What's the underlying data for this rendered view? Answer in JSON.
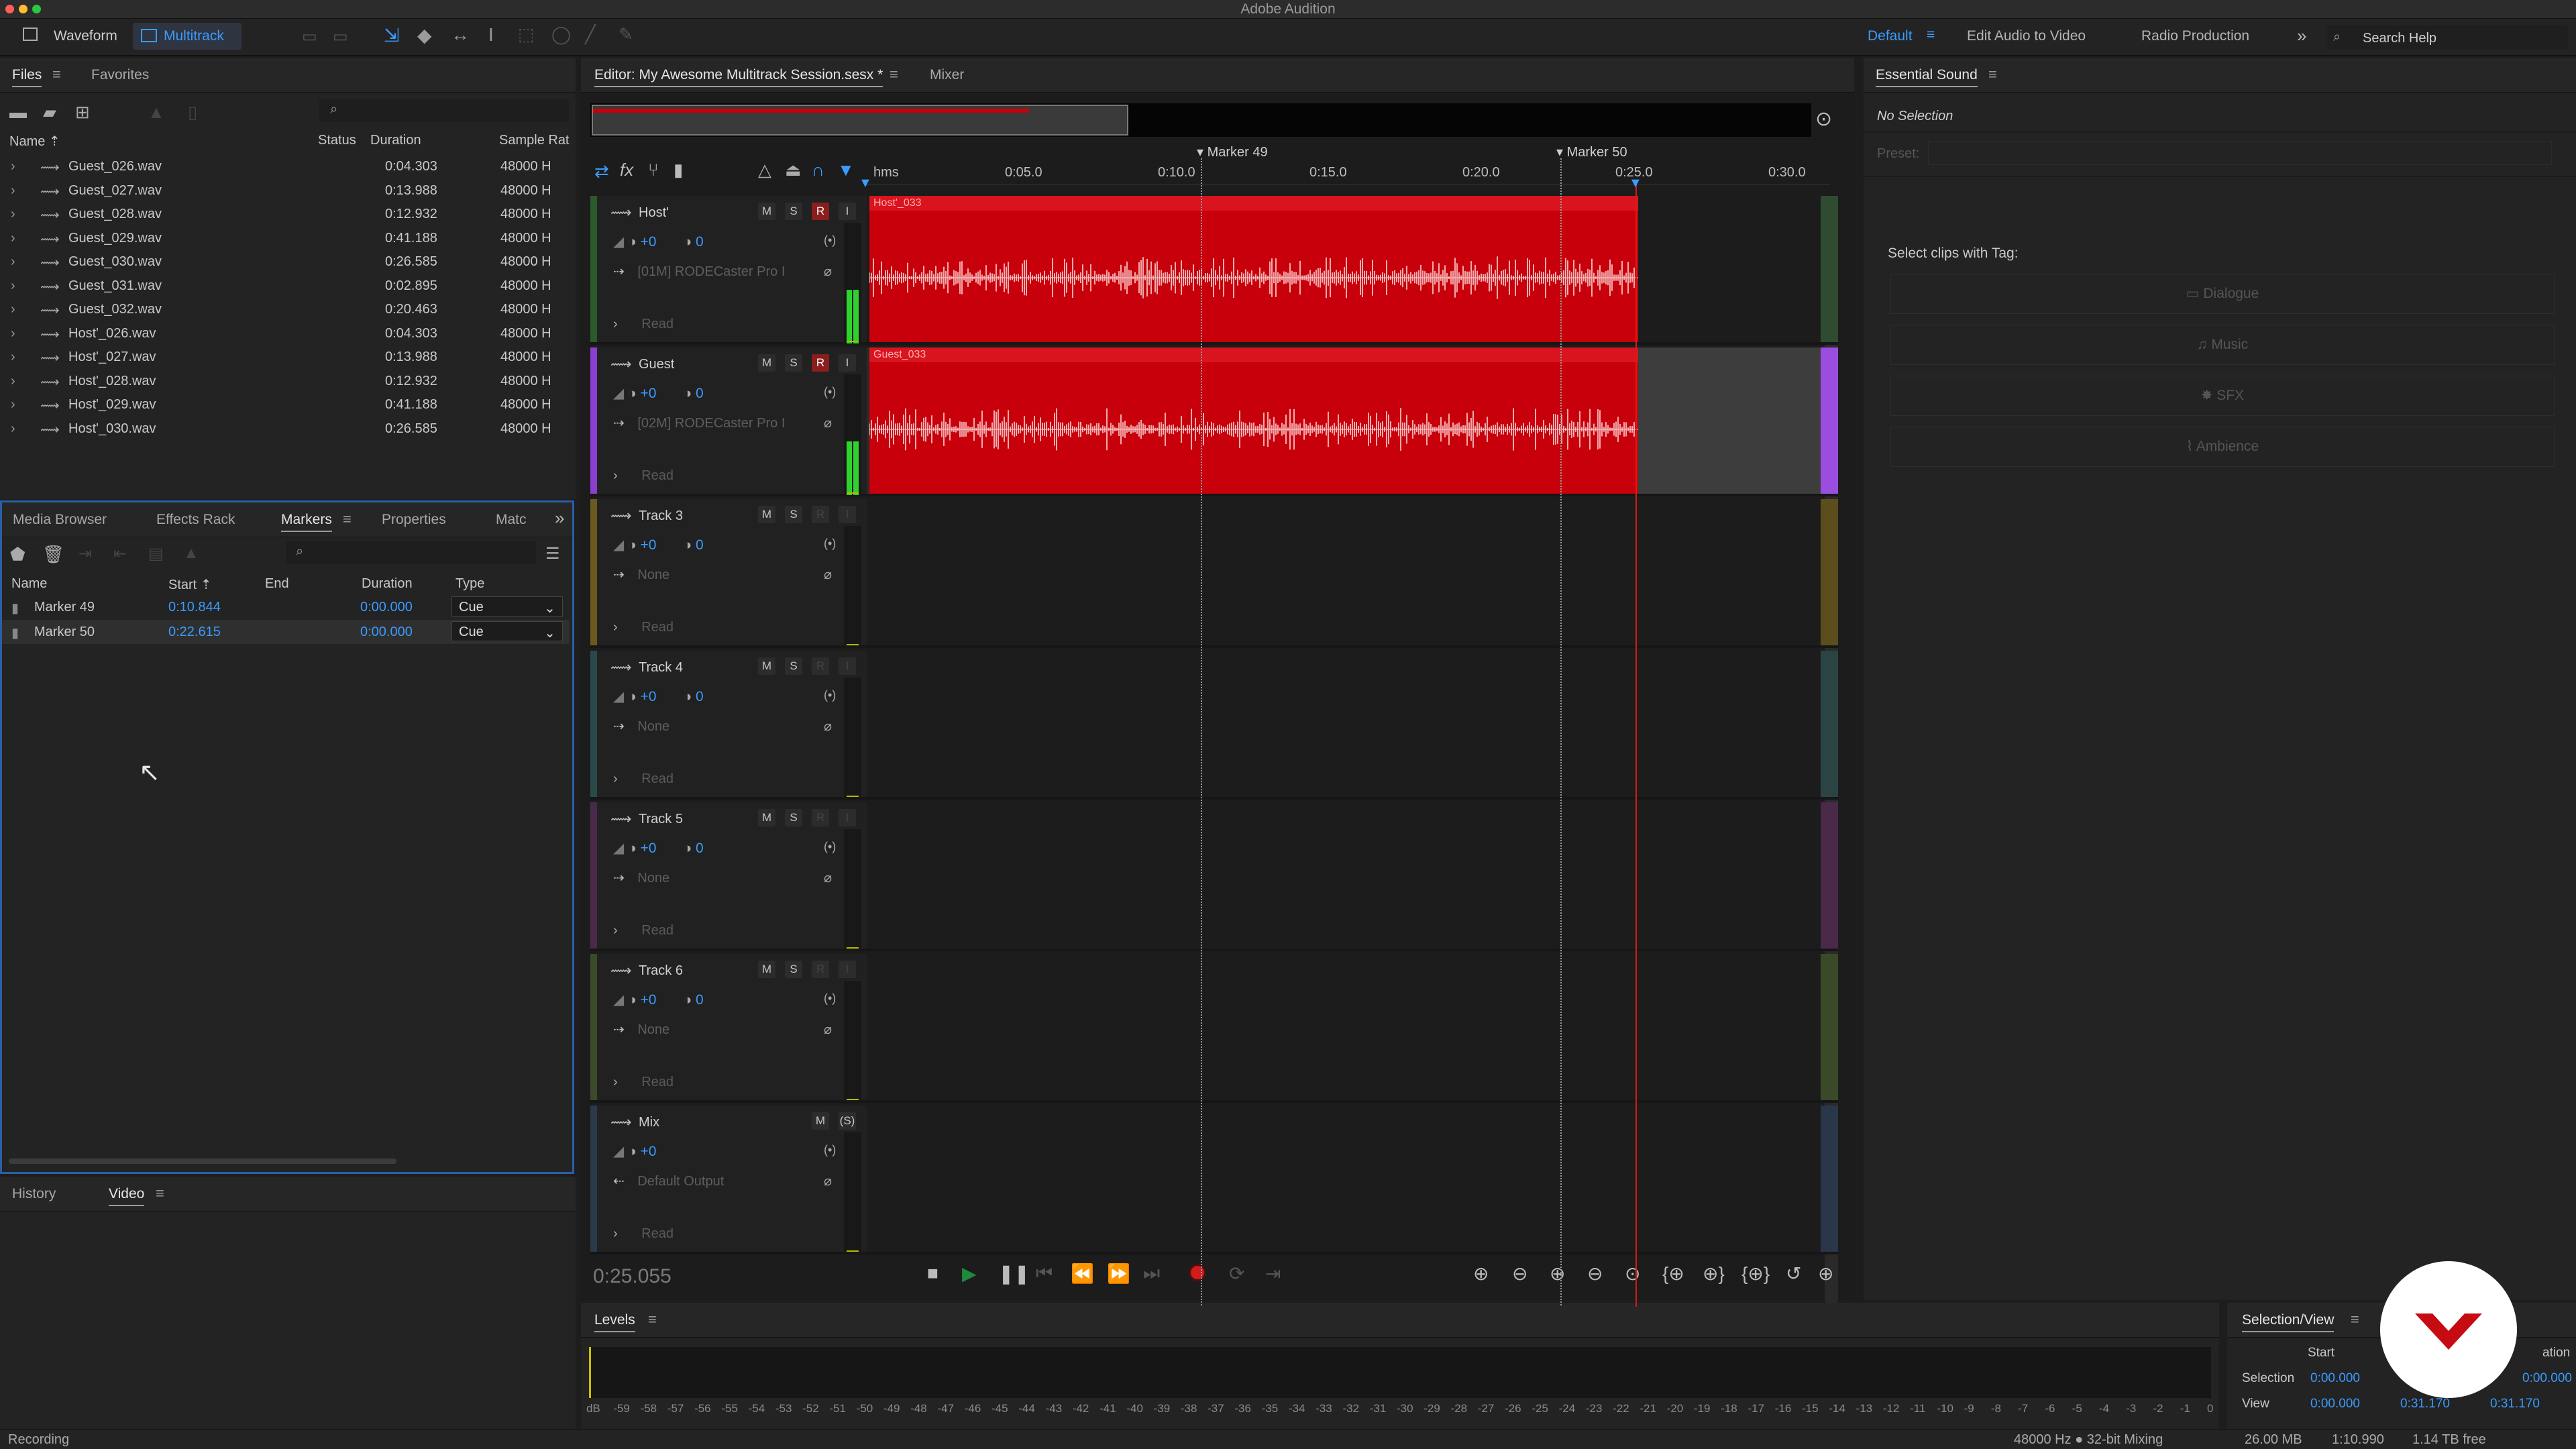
{
  "app": {
    "title": "Adobe Audition"
  },
  "topbar": {
    "waveform": "Waveform",
    "multitrack": "Multitrack",
    "workspaces": [
      "Default",
      "Edit Audio to Video",
      "Radio Production"
    ],
    "search_placeholder": "Search Help"
  },
  "files": {
    "tabs": [
      "Files",
      "Favorites"
    ],
    "columns": [
      "Name",
      "Status",
      "Duration",
      "Sample Rat"
    ],
    "rows": [
      {
        "name": "Guest_026.wav",
        "duration": "0:04.303",
        "rate": "48000 H"
      },
      {
        "name": "Guest_027.wav",
        "duration": "0:13.988",
        "rate": "48000 H"
      },
      {
        "name": "Guest_028.wav",
        "duration": "0:12.932",
        "rate": "48000 H"
      },
      {
        "name": "Guest_029.wav",
        "duration": "0:41.188",
        "rate": "48000 H"
      },
      {
        "name": "Guest_030.wav",
        "duration": "0:26.585",
        "rate": "48000 H"
      },
      {
        "name": "Guest_031.wav",
        "duration": "0:02.895",
        "rate": "48000 H"
      },
      {
        "name": "Guest_032.wav",
        "duration": "0:20.463",
        "rate": "48000 H"
      },
      {
        "name": "Host'_026.wav",
        "duration": "0:04.303",
        "rate": "48000 H"
      },
      {
        "name": "Host'_027.wav",
        "duration": "0:13.988",
        "rate": "48000 H"
      },
      {
        "name": "Host'_028.wav",
        "duration": "0:12.932",
        "rate": "48000 H"
      },
      {
        "name": "Host'_029.wav",
        "duration": "0:41.188",
        "rate": "48000 H"
      },
      {
        "name": "Host'_030.wav",
        "duration": "0:26.585",
        "rate": "48000 H"
      }
    ]
  },
  "markers": {
    "tabs": [
      "Media Browser",
      "Effects Rack",
      "Markers",
      "Properties",
      "Matc"
    ],
    "columns": [
      "Name",
      "Start",
      "End",
      "Duration",
      "Type"
    ],
    "rows": [
      {
        "name": "Marker 49",
        "start": "0:10.844",
        "end": "",
        "duration": "0:00.000",
        "type": "Cue"
      },
      {
        "name": "Marker 50",
        "start": "0:22.615",
        "end": "",
        "duration": "0:00.000",
        "type": "Cue"
      }
    ]
  },
  "history": {
    "tabs": [
      "History",
      "Video"
    ]
  },
  "editor": {
    "tab": "Editor: My Awesome Multitrack Session.sesx *",
    "mixer": "Mixer",
    "ruler_unit": "hms",
    "ticks": [
      "0:05.0",
      "0:10.0",
      "0:15.0",
      "0:20.0",
      "0:25.0",
      "0:30.0"
    ],
    "marker_labels": [
      "Marker 49",
      "Marker 50"
    ],
    "time": "0:25.055",
    "tracks": [
      {
        "name": "Host'",
        "gain": "+0",
        "pan": "0",
        "input": "[01M] RODECaster Pro I",
        "mode": "Read",
        "clip": "Host'_033"
      },
      {
        "name": "Guest",
        "gain": "+0",
        "pan": "0",
        "input": "[02M] RODECaster Pro I",
        "mode": "Read",
        "clip": "Guest_033"
      },
      {
        "name": "Track 3",
        "gain": "+0",
        "pan": "0",
        "input": "None",
        "mode": "Read"
      },
      {
        "name": "Track 4",
        "gain": "+0",
        "pan": "0",
        "input": "None",
        "mode": "Read"
      },
      {
        "name": "Track 5",
        "gain": "+0",
        "pan": "0",
        "input": "None",
        "mode": "Read"
      },
      {
        "name": "Track 6",
        "gain": "+0",
        "pan": "0",
        "input": "None",
        "mode": "Read"
      },
      {
        "name": "Mix",
        "gain": "+0",
        "input": "Default Output",
        "mode": "Read"
      }
    ],
    "colors": {
      "clip": "#c7000b",
      "guest_accent": "#8b3fd1"
    }
  },
  "essential": {
    "title": "Essential Sound",
    "no_selection": "No Selection",
    "preset": "Preset:",
    "tag_label": "Select clips with Tag:",
    "tags": [
      "Dialogue",
      "Music",
      "SFX",
      "Ambience"
    ]
  },
  "levels": {
    "title": "Levels",
    "scale": [
      "dB",
      "-59",
      "-58",
      "-57",
      "-56",
      "-55",
      "-54",
      "-53",
      "-52",
      "-51",
      "-50",
      "-49",
      "-48",
      "-47",
      "-46",
      "-45",
      "-44",
      "-43",
      "-42",
      "-41",
      "-40",
      "-39",
      "-38",
      "-37",
      "-36",
      "-35",
      "-34",
      "-33",
      "-32",
      "-31",
      "-30",
      "-29",
      "-28",
      "-27",
      "-26",
      "-25",
      "-24",
      "-23",
      "-22",
      "-21",
      "-20",
      "-19",
      "-18",
      "-17",
      "-16",
      "-15",
      "-14",
      "-13",
      "-12",
      "-11",
      "-10",
      "-9",
      "-8",
      "-7",
      "-6",
      "-5",
      "-4",
      "-3",
      "-2",
      "-1",
      "0"
    ]
  },
  "selview": {
    "title": "Selection/View",
    "start": "Start",
    "duration": "ation",
    "selection": "Selection",
    "view": "View",
    "sel_start": "0:00.000",
    "sel_dur": "0:00.000",
    "view_start": "0:00.000",
    "view_end": "0:31.170",
    "view_dur": "0:31.170"
  },
  "status": {
    "left": "Recording",
    "info": "48000 Hz ● 32-bit Mixing",
    "size": "26.00 MB",
    "time": "1:10.990",
    "free": "1.14 TB free"
  }
}
